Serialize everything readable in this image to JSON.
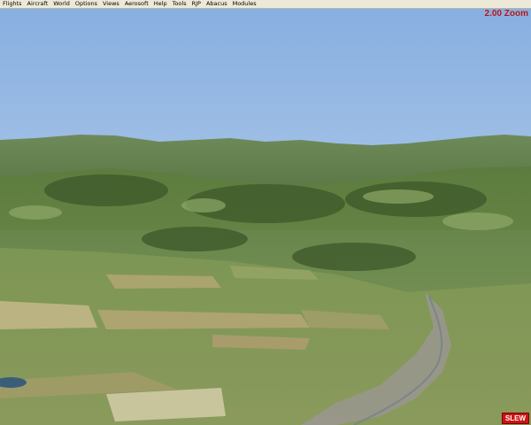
{
  "menubar": {
    "items": [
      "Flights",
      "Aircraft",
      "World",
      "Options",
      "Views",
      "Aerosoft",
      "Help",
      "Tools",
      "RJP",
      "Abacus",
      "Modules"
    ]
  },
  "overlay": {
    "zoom": "2.00 Zoom",
    "mode": "SLEW"
  },
  "colors": {
    "sky_top": "#86aee0",
    "sky_horizon": "#c9dcef",
    "terrain_green": "#5a7a3c",
    "field_tan": "#b8a878",
    "zoom_text": "#b0101a",
    "slew_bg": "#cc1414"
  }
}
